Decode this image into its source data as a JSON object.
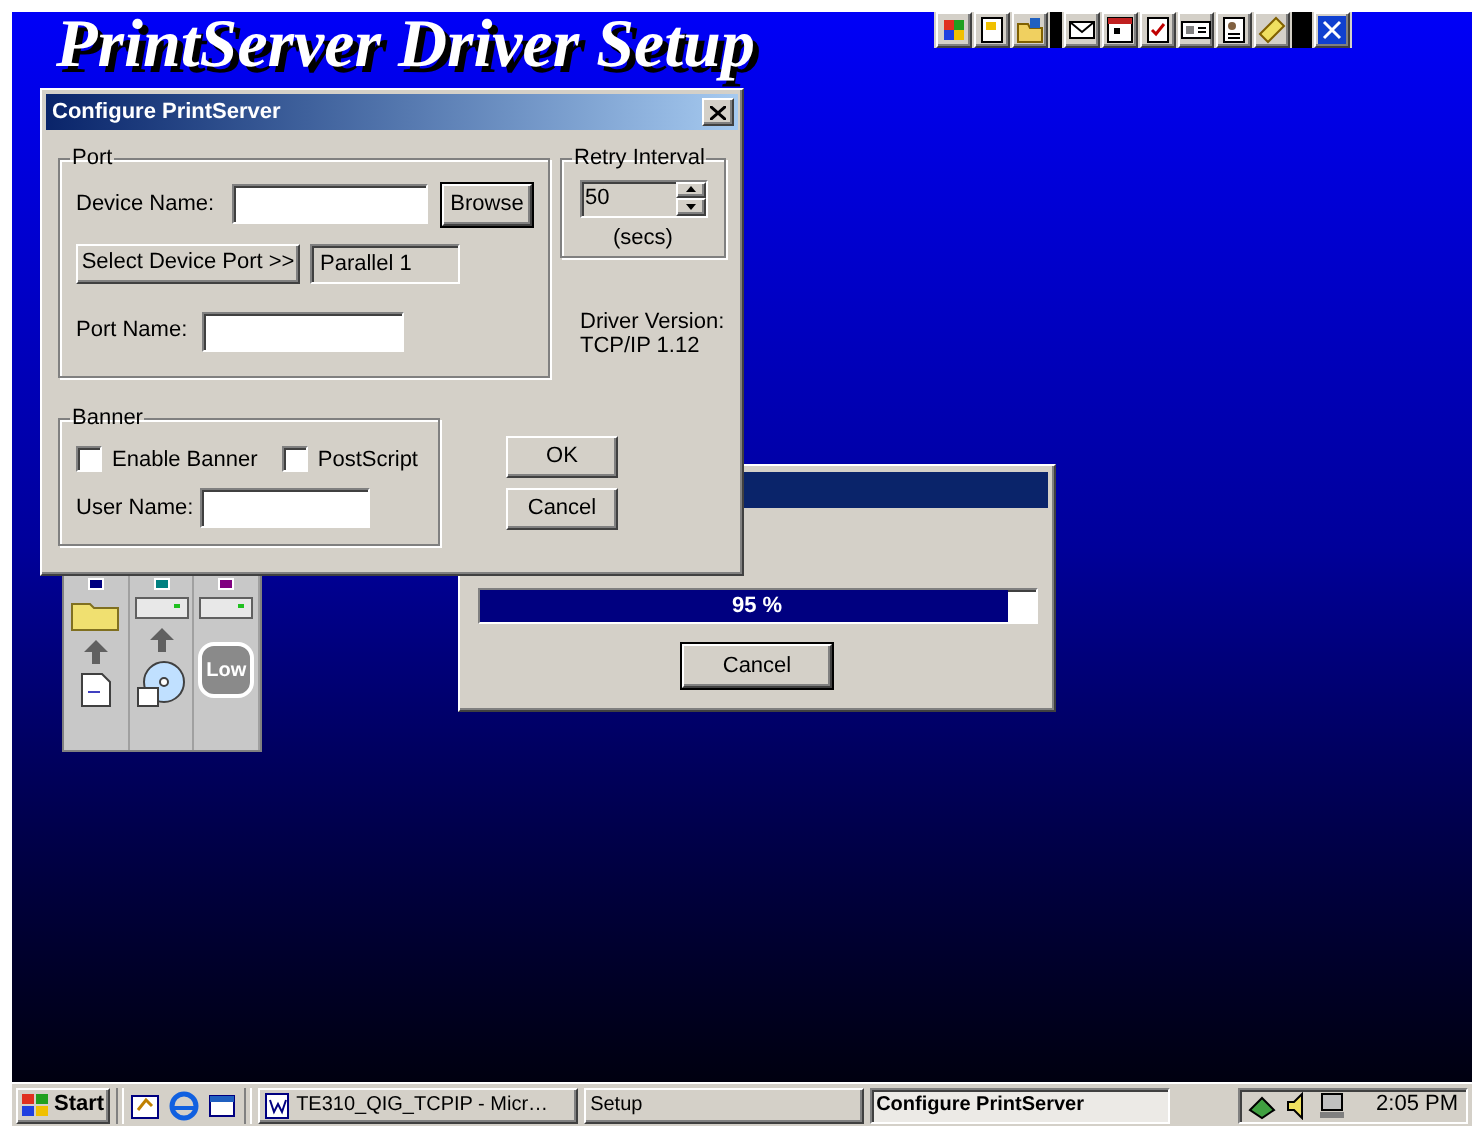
{
  "desktop": {
    "title": "PrintServer Driver Setup"
  },
  "dialog": {
    "title": "Configure PrintServer",
    "port": {
      "legend": "Port",
      "device_name_label": "Device Name:",
      "browse_button": "Browse",
      "select_port_button": "Select Device Port >>",
      "port_value": "Parallel 1",
      "port_name_label": "Port Name:"
    },
    "retry": {
      "legend": "Retry Interval",
      "value": "50",
      "unit": "(secs)"
    },
    "driver_version": [
      "Driver Version:",
      "TCP/IP 1.12"
    ],
    "banner": {
      "legend": "Banner",
      "options": [
        {
          "label": "Enable Banner",
          "checked": false
        },
        {
          "label": "PostScript",
          "checked": false
        }
      ],
      "user_name_label": "User Name:"
    },
    "buttons": [
      "OK",
      "Cancel"
    ]
  },
  "progress_dialog": {
    "level": 0.95,
    "reading": "95 %",
    "button": "Cancel"
  },
  "toolbar": {
    "columns": [
      {
        "color": "#000080"
      },
      {
        "color": "#008080"
      },
      {
        "color": "#800080"
      }
    ],
    "low_label": "Low"
  },
  "taskbar": {
    "start": "Start",
    "tasks": [
      {
        "label": "TE310_QIG_TCPIP - Micr…",
        "kind": "document",
        "selected": false
      },
      {
        "label": "Setup",
        "kind": "plain",
        "selected": false
      },
      {
        "label": "Configure PrintServer",
        "kind": "plain",
        "selected": true
      }
    ],
    "clock": "2:05 PM"
  }
}
